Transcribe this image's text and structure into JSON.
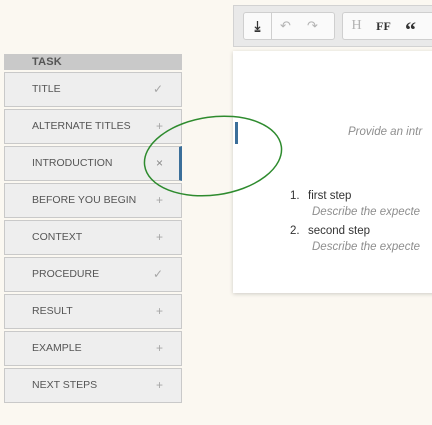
{
  "sidebar": {
    "header": "TASK",
    "items": [
      {
        "label": "TITLE",
        "status": "✓"
      },
      {
        "label": "ALTERNATE TITLES",
        "status": "+"
      },
      {
        "label": "INTRODUCTION",
        "status": "×"
      },
      {
        "label": "BEFORE YOU BEGIN",
        "status": "+"
      },
      {
        "label": "CONTEXT",
        "status": "+"
      },
      {
        "label": "PROCEDURE",
        "status": "✓"
      },
      {
        "label": "RESULT",
        "status": "+"
      },
      {
        "label": "EXAMPLE",
        "status": "+"
      },
      {
        "label": "NEXT STEPS",
        "status": "+"
      }
    ]
  },
  "toolbar": {
    "download_icon": "⤓",
    "undo_icon": "↶",
    "redo_icon": "↷",
    "heading_label": "H",
    "font_label": "FF",
    "quote_label": "“"
  },
  "editor": {
    "intro_placeholder": "Provide an intr",
    "steps": [
      {
        "number": "1.",
        "text": "first step",
        "desc": "Describe the expecte"
      },
      {
        "number": "2.",
        "text": "second step",
        "desc": "Describe the expecte"
      }
    ]
  },
  "colors": {
    "accent": "#3b6f9a",
    "callout": "#2e8b2e"
  }
}
